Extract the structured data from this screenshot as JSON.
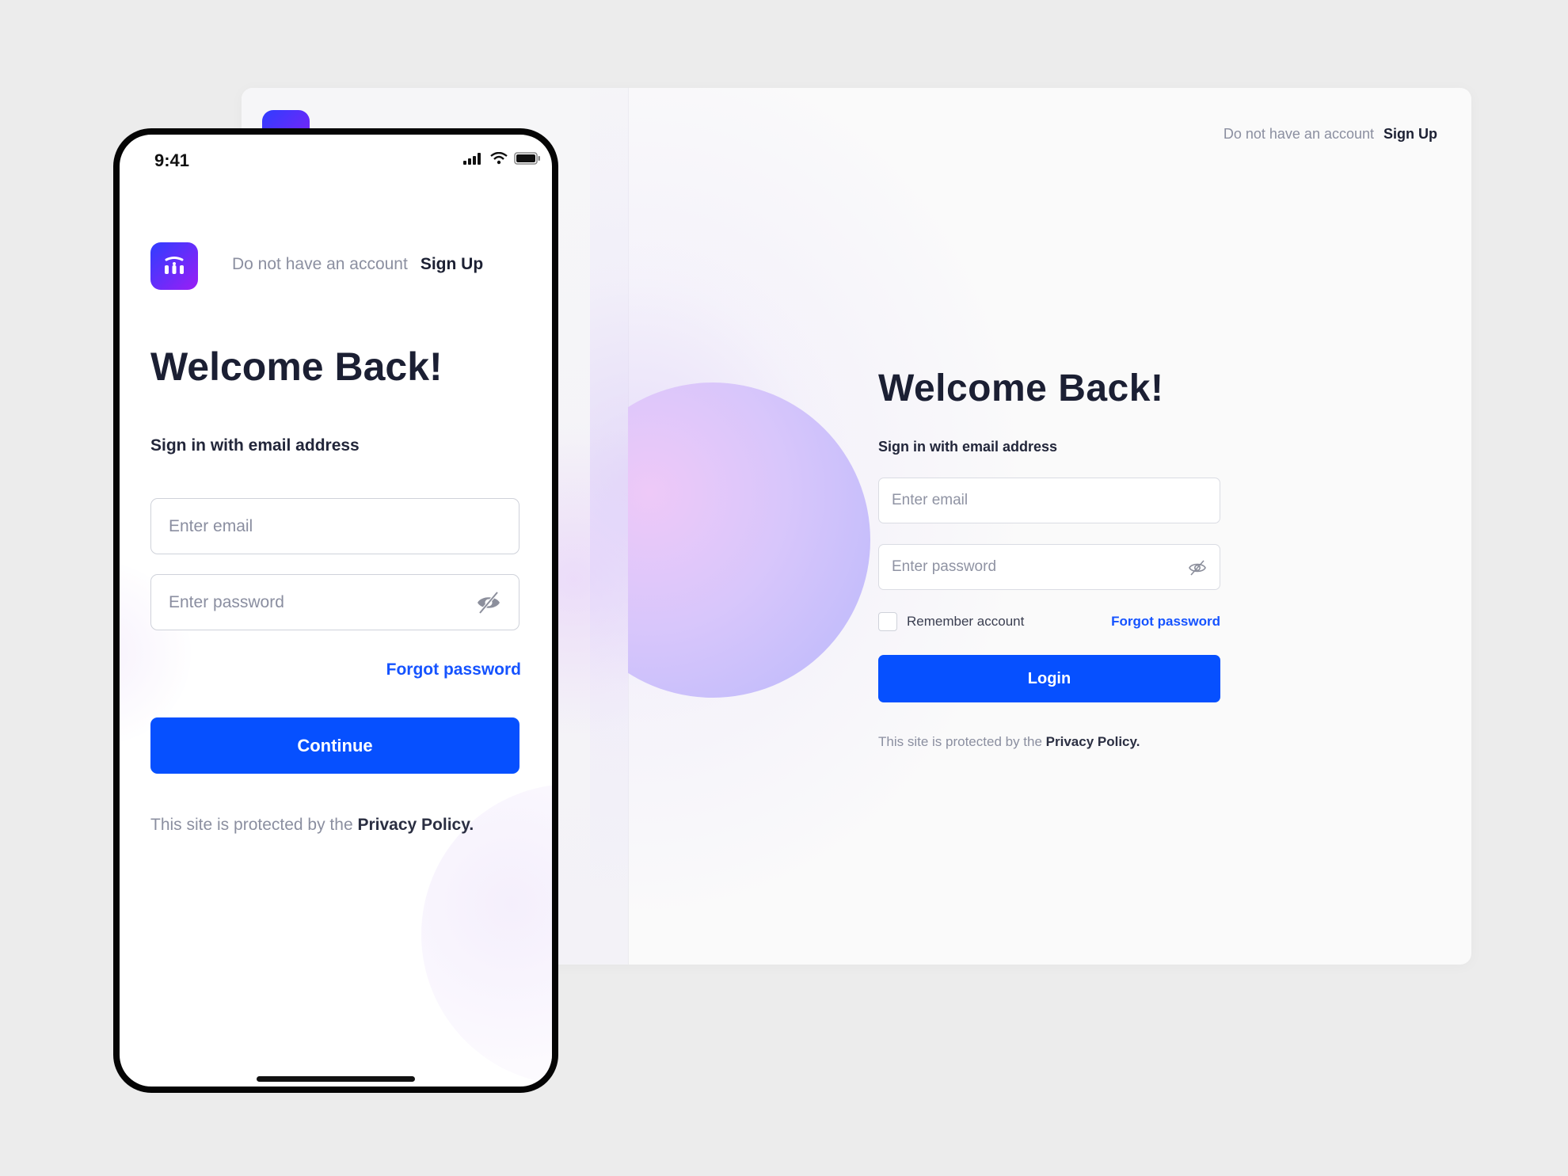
{
  "desktop": {
    "header": {
      "no_account_text": "Do not have an account",
      "signup_label": "Sign Up"
    },
    "title": "Welcome Back!",
    "subtitle": "Sign in with email address",
    "email_placeholder": "Enter email",
    "password_placeholder": "Enter password",
    "remember_label": "Remember account",
    "forgot_label": "Forgot password",
    "login_label": "Login",
    "footer_text": "This site is protected by the",
    "footer_link": "Privacy Policy."
  },
  "mobile": {
    "status_time": "9:41",
    "header": {
      "no_account_text": "Do not have an account",
      "signup_label": "Sign Up"
    },
    "title": "Welcome Back!",
    "subtitle": "Sign in with email address",
    "email_placeholder": "Enter email",
    "password_placeholder": "Enter password",
    "forgot_label": "Forgot password",
    "continue_label": "Continue",
    "footer_text": "This site is protected by the",
    "footer_link": "Privacy Policy."
  },
  "colors": {
    "accent": "#0650ff",
    "link": "#1553ff",
    "logo_gradient_start": "#2f3dff",
    "logo_gradient_end": "#9b1ef5",
    "heading": "#1b1f33",
    "muted": "#8b8fa0"
  },
  "icons": [
    "app-logo-icon",
    "eye-off-icon",
    "signal-icon",
    "wifi-icon",
    "battery-icon"
  ]
}
